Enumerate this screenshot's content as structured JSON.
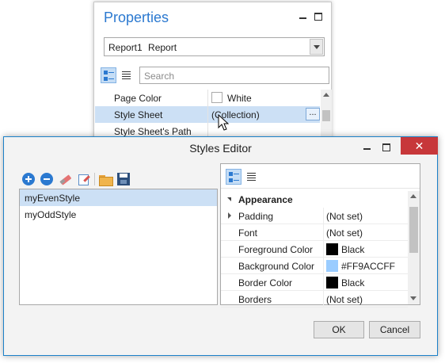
{
  "properties_panel": {
    "title": "Properties",
    "selector": {
      "name": "Report1",
      "type": "Report"
    },
    "search_placeholder": "Search",
    "rows": [
      {
        "name": "Page Color",
        "value": "White",
        "swatch": "#ffffff"
      },
      {
        "name": "Style Sheet",
        "value": "(Collection)",
        "ellipsis": "..."
      },
      {
        "name": "Style Sheet's Path",
        "value": ""
      }
    ]
  },
  "styles_editor": {
    "title": "Styles Editor",
    "close_glyph": "✕",
    "toolbar_icons": [
      "add-icon",
      "remove-icon",
      "eraser-icon",
      "edit-icon",
      "open-folder-icon",
      "save-icon"
    ],
    "styles": [
      "myEvenStyle",
      "myOddStyle"
    ],
    "selected_style_index": 0,
    "property_grid": {
      "category": "Appearance",
      "rows": [
        {
          "name": "Padding",
          "value": "(Not set)",
          "expandable": true
        },
        {
          "name": "Font",
          "value": "(Not set)"
        },
        {
          "name": "Foreground Color",
          "value": "Black",
          "swatch": "#000000"
        },
        {
          "name": "Background Color",
          "value": "#FF9ACCFF",
          "swatch": "#9accff"
        },
        {
          "name": "Border Color",
          "value": "Black",
          "swatch": "#000000"
        },
        {
          "name": "Borders",
          "value": "(Not set)"
        }
      ]
    },
    "ok_label": "OK",
    "cancel_label": "Cancel"
  },
  "colors": {
    "accent_blue": "#2b79d0",
    "selection": "#cce0f5",
    "close_red": "#c7373a",
    "dialog_border": "#1c81c9"
  }
}
